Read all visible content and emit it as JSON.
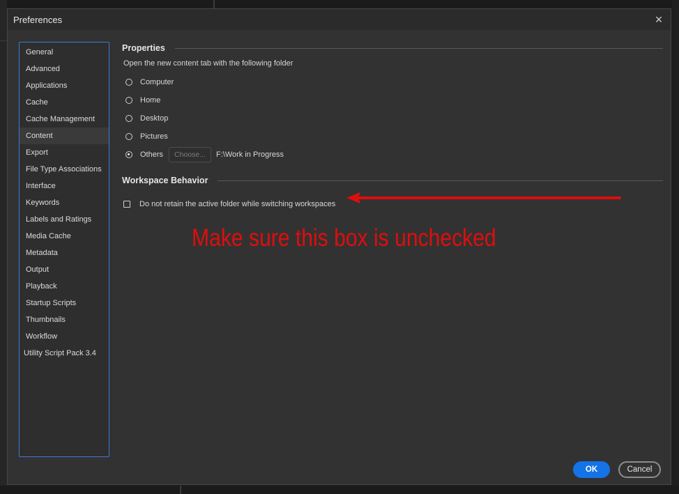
{
  "dialog": {
    "title": "Preferences",
    "close_icon": "×"
  },
  "sidebar": {
    "items": [
      {
        "label": "General"
      },
      {
        "label": "Advanced"
      },
      {
        "label": "Applications"
      },
      {
        "label": "Cache"
      },
      {
        "label": "Cache Management"
      },
      {
        "label": "Content",
        "selected": true
      },
      {
        "label": "Export"
      },
      {
        "label": "File Type Associations"
      },
      {
        "label": "Interface"
      },
      {
        "label": "Keywords"
      },
      {
        "label": "Labels and Ratings"
      },
      {
        "label": "Media Cache"
      },
      {
        "label": "Metadata"
      },
      {
        "label": "Output"
      },
      {
        "label": "Playback"
      },
      {
        "label": "Startup Scripts"
      },
      {
        "label": "Thumbnails"
      },
      {
        "label": "Workflow"
      },
      {
        "label": "Utility Script Pack 3.4"
      }
    ]
  },
  "properties": {
    "heading": "Properties",
    "subtitle": "Open the new content tab with the following folder",
    "options": [
      {
        "label": "Computer",
        "checked": false
      },
      {
        "label": "Home",
        "checked": false
      },
      {
        "label": "Desktop",
        "checked": false
      },
      {
        "label": "Pictures",
        "checked": false
      },
      {
        "label": "Others",
        "checked": true
      }
    ],
    "choose_label": "Choose...",
    "folder_path": "F:\\Work in Progress"
  },
  "workspace": {
    "heading": "Workspace Behavior",
    "checkbox_label": "Do not retain the active folder while switching workspaces",
    "checkbox_checked": false
  },
  "annotation": {
    "text": "Make sure this box is unchecked",
    "color": "#e00d0d"
  },
  "buttons": {
    "ok": "OK",
    "cancel": "Cancel"
  },
  "colors": {
    "accent": "#1473e6",
    "selection_border": "#3f7ad8"
  }
}
